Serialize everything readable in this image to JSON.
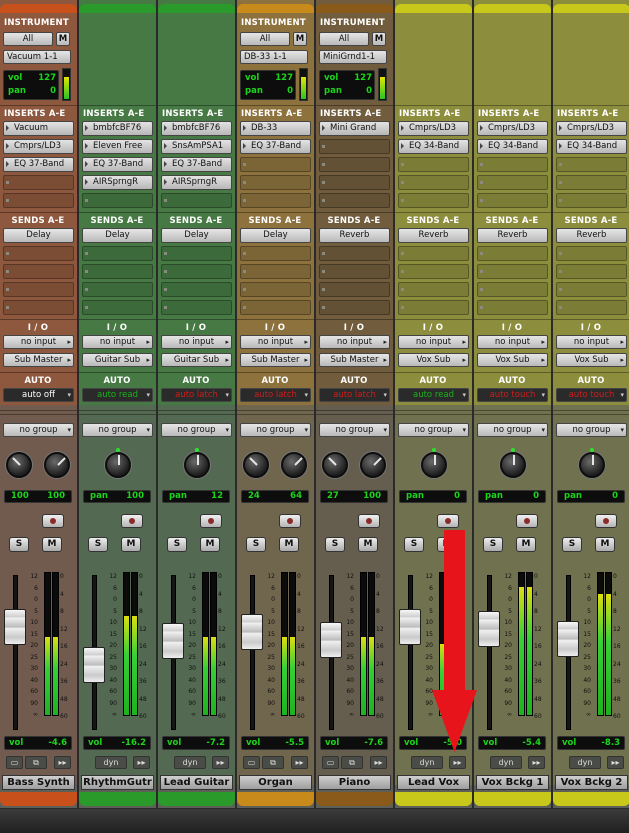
{
  "headers": {
    "instrument": "INSTRUMENT",
    "inserts": "INSERTS A-E",
    "sends": "SENDS A-E",
    "io": "I / O",
    "auto": "AUTO"
  },
  "colors": {
    "accent_red": "#e8141c",
    "meter_green": "#26c526",
    "display_green": "#1bd51b"
  },
  "tracks": [
    {
      "name": "Bass Synth",
      "color": "#c8501a",
      "instrument": true,
      "inst_in": "All",
      "inst_plugin": "Vacuum 1-1",
      "inst_vol": "127",
      "inst_pan": "0",
      "inserts": [
        "Vacuum",
        "Cmprs/LD3",
        "EQ 37-Band"
      ],
      "sends": [
        "Delay"
      ],
      "io_in": "no input",
      "io_out": "Sub Master",
      "auto": "auto off",
      "auto_color": "#ffffff",
      "group": "no group",
      "knobs": 2,
      "pan_left": "100",
      "pan_right": "100",
      "pan_label": "",
      "vol": "-4.6",
      "fader_pos": 0.74,
      "meter": 0.55,
      "foot": "icons"
    },
    {
      "name": "RhythmGutr",
      "color": "#2a9a2a",
      "instrument": false,
      "inserts": [
        "bmbfcBF76",
        "Eleven Free",
        "EQ 37-Band",
        "AIRSprngR"
      ],
      "sends": [
        "Delay"
      ],
      "io_in": "no input",
      "io_out": "Guitar Sub",
      "auto": "auto read",
      "auto_color": "#1db21d",
      "group": "no group",
      "knobs": 1,
      "pan_label": "pan",
      "pan_right": "100",
      "vol": "-16.2",
      "fader_pos": 0.45,
      "meter": 0.7,
      "foot": "dyn"
    },
    {
      "name": "Lead Guitar",
      "color": "#2a9a2a",
      "instrument": false,
      "inserts": [
        "bmbfcBF76",
        "SnsAmPSA1",
        "EQ 37-Band",
        "AIRSprngR"
      ],
      "sends": [
        "Delay"
      ],
      "io_in": "no input",
      "io_out": "Guitar Sub",
      "auto": "auto latch",
      "auto_color": "#d01d1d",
      "group": "no group",
      "knobs": 1,
      "pan_label": "pan",
      "pan_right": "12",
      "vol": "-7.2",
      "fader_pos": 0.63,
      "meter": 0.55,
      "foot": "dyn"
    },
    {
      "name": "Organ",
      "color": "#c88a1a",
      "instrument": true,
      "inst_in": "All",
      "inst_plugin": "DB-33 1-1",
      "inst_vol": "127",
      "inst_pan": "0",
      "inserts": [
        "DB-33",
        "EQ 37-Band"
      ],
      "sends": [
        "Delay"
      ],
      "io_in": "no input",
      "io_out": "Sub Master",
      "auto": "auto latch",
      "auto_color": "#d01d1d",
      "group": "no group",
      "knobs": 2,
      "pan_left": "24",
      "pan_right": "64",
      "pan_label": "",
      "vol": "-5.5",
      "fader_pos": 0.7,
      "meter": 0.55,
      "foot": "icons"
    },
    {
      "name": "Piano",
      "color": "#8a5a1a",
      "instrument": true,
      "inst_in": "All",
      "inst_plugin": "MiniGrnd1-1",
      "inst_vol": "127",
      "inst_pan": "0",
      "inserts": [
        "Mini Grand"
      ],
      "sends": [
        "Reverb"
      ],
      "io_in": "no input",
      "io_out": "Sub Master",
      "auto": "auto latch",
      "auto_color": "#d01d1d",
      "group": "no group",
      "knobs": 2,
      "pan_left": "27",
      "pan_right": "100",
      "pan_label": "",
      "vol": "-7.6",
      "fader_pos": 0.64,
      "meter": 0.55,
      "foot": "icons"
    },
    {
      "name": "Lead Vox",
      "color": "#c8c81a",
      "instrument": false,
      "inserts": [
        "Cmprs/LD3",
        "EQ 34-Band"
      ],
      "sends": [
        "Reverb"
      ],
      "io_in": "no input",
      "io_out": "Vox Sub",
      "auto": "auto read",
      "auto_color": "#1db21d",
      "group": "no group",
      "knobs": 1,
      "pan_label": "pan",
      "pan_right": "0",
      "vol": "-5.0",
      "fader_pos": 0.74,
      "meter": 0.5,
      "foot": "dyn"
    },
    {
      "name": "Vox Bckg 1",
      "color": "#c8c81a",
      "instrument": false,
      "inserts": [
        "Cmprs/LD3",
        "EQ 34-Band"
      ],
      "sends": [
        "Reverb"
      ],
      "io_in": "no input",
      "io_out": "Vox Sub",
      "auto": "auto touch",
      "auto_color": "#d01d1d",
      "group": "no group",
      "knobs": 1,
      "pan_label": "pan",
      "pan_right": "0",
      "vol": "-5.4",
      "fader_pos": 0.72,
      "meter": 0.9,
      "foot": "dyn"
    },
    {
      "name": "Vox Bckg 2",
      "color": "#c8c81a",
      "instrument": false,
      "inserts": [
        "Cmprs/LD3",
        "EQ 34-Band"
      ],
      "sends": [
        "Reverb"
      ],
      "io_in": "no input",
      "io_out": "Vox Sub",
      "auto": "auto touch",
      "auto_color": "#d01d1d",
      "group": "no group",
      "knobs": 1,
      "pan_label": "pan",
      "pan_right": "0",
      "vol": "-8.3",
      "fader_pos": 0.65,
      "meter": 0.85,
      "foot": "dyn"
    }
  ],
  "labels": {
    "vol": "vol",
    "pan": "pan",
    "solo": "S",
    "mute": "M",
    "dyn": "dyn",
    "inst_m": "M"
  },
  "fader_scale": [
    "12",
    "6",
    "0",
    "5",
    "10",
    "15",
    "20",
    "25",
    "30",
    "40",
    "60",
    "90",
    "∞"
  ],
  "meter_scale": [
    "0",
    "4",
    "8",
    "12",
    "16",
    "24",
    "36",
    "48",
    "60"
  ]
}
